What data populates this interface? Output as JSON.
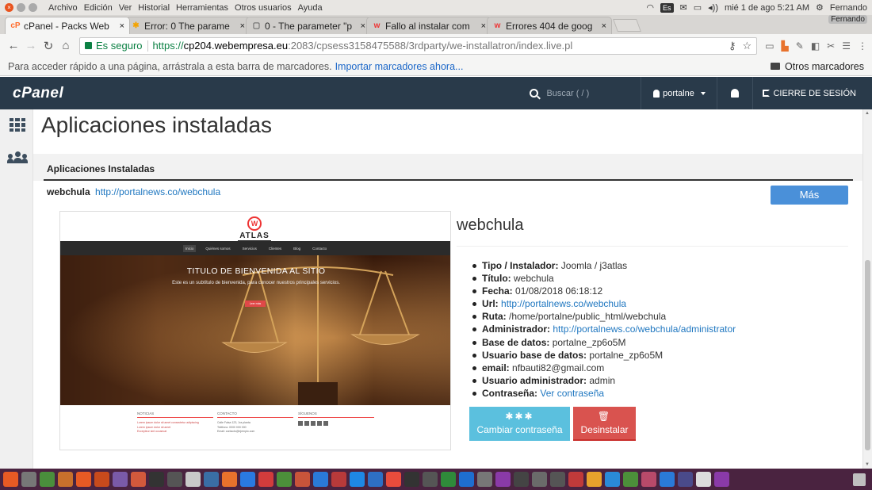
{
  "os_bar": {
    "menu": [
      "Archivo",
      "Edición",
      "Ver",
      "Historial",
      "Herramientas",
      "Otros usuarios",
      "Ayuda"
    ],
    "keyboard": "Es",
    "datetime": "mié 1 de ago  5:21 AM",
    "user": "Fernando",
    "user_badge": "Fernando"
  },
  "tabs": [
    {
      "title": "cPanel - Packs Web",
      "icon": "cpanel-icon",
      "icon_glyph": "cP",
      "icon_color": "#ff6c2c",
      "active": true
    },
    {
      "title": "Error: 0 The parame",
      "icon": "joomla-icon",
      "icon_glyph": "✱",
      "icon_color": "#f4a300",
      "active": false
    },
    {
      "title": "0 - The parameter \"p",
      "icon": "page-icon",
      "icon_glyph": "▢",
      "icon_color": "#666",
      "active": false
    },
    {
      "title": "Fallo al instalar com",
      "icon": "webempresa-icon",
      "icon_glyph": "w",
      "icon_color": "#e33",
      "active": false
    },
    {
      "title": "Errores 404 de goog",
      "icon": "webempresa-icon",
      "icon_glyph": "w",
      "icon_color": "#e33",
      "active": false
    }
  ],
  "address_bar": {
    "secure_label": "Es seguro",
    "url_scheme": "https://",
    "url_host": "cp204.webempresa.eu",
    "url_rest": ":2083/cpsess3158475588/3rdparty/we-installatron/index.live.pl"
  },
  "bookmarks": {
    "hint": "Para acceder rápido a una página, arrástrala a esta barra de marcadores.",
    "import_link": "Importar marcadores ahora...",
    "other": "Otros marcadores"
  },
  "cpanel_header": {
    "logo": "cPanel",
    "search_placeholder": "Buscar ( / )",
    "user": "portalne",
    "logout": "CIERRE DE SESIÓN"
  },
  "page": {
    "title": "Aplicaciones instaladas",
    "section_title": "Aplicaciones Instaladas",
    "app_name": "webchula",
    "app_url": "http://portalnews.co/webchula",
    "more_button": "Más"
  },
  "preview": {
    "logo_text": "ATLAS",
    "logo_mark": "W",
    "nav": [
      "Inicio",
      "Quiénes somos",
      "Servicios",
      "Clientes",
      "Blog",
      "Contacto"
    ],
    "hero_title": "TITULO DE BIENVENIDA AL SITIO",
    "hero_sub": "Este es un subtítulo de bienvenida, para conocer nuestros principales servicios.",
    "hero_button": "Leer más",
    "footer_cols": [
      {
        "title": "NOTICIAS",
        "lines": [
          "Lorem ipsum dolor sit amet consectetur adipiscing",
          "Lorem ipsum dolor sit amet",
          "Excepteur sint occaecat"
        ]
      },
      {
        "title": "CONTACTO",
        "lines": [
          "Calle Falsa 123, 1ra planta",
          "Teléfono: 0000 000 000",
          "Email: contacto@ejemplo.com"
        ]
      },
      {
        "title": "SÍGUENOS",
        "lines": []
      }
    ]
  },
  "details": {
    "title": "webchula",
    "rows": [
      {
        "label": "Tipo / Instalador:",
        "value": "Joomla / j3atlas",
        "link": false
      },
      {
        "label": "Título:",
        "value": "webchula",
        "link": false
      },
      {
        "label": "Fecha:",
        "value": "01/08/2018 06:18:12",
        "link": false
      },
      {
        "label": "Url:",
        "value": "http://portalnews.co/webchula",
        "link": true
      },
      {
        "label": "Ruta:",
        "value": "/home/portalne/public_html/webchula",
        "link": false
      },
      {
        "label": "Administrador:",
        "value": "http://portalnews.co/webchula/administrator",
        "link": true
      },
      {
        "label": "Base de datos:",
        "value": "portalne_zp6o5M",
        "link": false
      },
      {
        "label": "Usuario base de datos:",
        "value": "portalne_zp6o5M",
        "link": false
      },
      {
        "label": "email:",
        "value": "nfbauti82@gmail.com",
        "link": false
      },
      {
        "label": "Usuario administrador:",
        "value": "admin",
        "link": false
      },
      {
        "label": "Contraseña:",
        "value": "Ver contraseña",
        "link": true
      }
    ],
    "btn_change_password": "Cambiar contraseña",
    "btn_change_password_icon": "✱✱✱",
    "btn_uninstall": "Desinstalar",
    "btn_uninstall_icon": "🗑"
  },
  "taskbar": {
    "icons": [
      "#e85a24",
      "#777",
      "#4a8e3c",
      "#c8702c",
      "#e85a24",
      "#c84a1c",
      "#7a5aa8",
      "#d2593c",
      "#333",
      "#555",
      "#c9c9c9",
      "#3a6ea5",
      "#e8722c",
      "#2a7ae2",
      "#d23c3c",
      "#4c8f3a",
      "#c8543a",
      "#2a7ad8",
      "#b83a3a",
      "#1e88e5",
      "#2e6fc4",
      "#e94c3c",
      "#333",
      "#555",
      "#2f8a3a",
      "#1e6ed0",
      "#777",
      "#8a3aa8",
      "#444",
      "#6a6a6a",
      "#555",
      "#c03a3a",
      "#e8a22c",
      "#2a8ad8",
      "#4c8f3a",
      "#b84a6a",
      "#2a7ad8",
      "#4a4a8a",
      "#dcdcdc",
      "#8a3aa8"
    ]
  }
}
